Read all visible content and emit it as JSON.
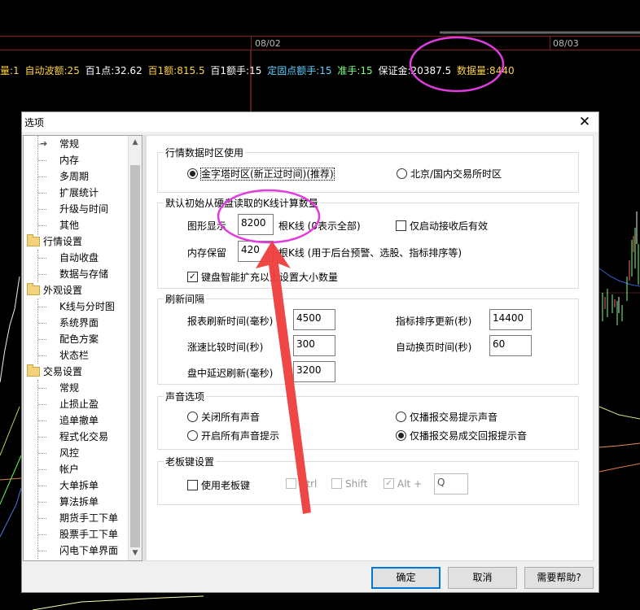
{
  "chart": {
    "dates": [
      "08/02",
      "08/03"
    ],
    "stats": [
      {
        "text": "量:1",
        "color": "#ffd23f"
      },
      {
        "text": "自动波额:25",
        "color": "#ffd23f"
      },
      {
        "text": "百1点:32.62",
        "color": "#ffffff"
      },
      {
        "text": "百1额:815.5",
        "color": "#ffd23f"
      },
      {
        "text": "百1额手:15",
        "color": "#ffffff"
      },
      {
        "text": "定固点额手:15",
        "color": "#5ad1ff"
      },
      {
        "text": "准手:15",
        "color": "#7dff7d"
      },
      {
        "text": "保证金:20387.5",
        "color": "#ffffff"
      },
      {
        "text": "数据量:8440",
        "color": "#ffd23f"
      }
    ]
  },
  "dialog": {
    "title": "选项",
    "close_glyph": "✕",
    "tree": {
      "items": [
        {
          "label": "常规",
          "level": 2,
          "selected": true
        },
        {
          "label": "内存",
          "level": 2
        },
        {
          "label": "多周期",
          "level": 2
        },
        {
          "label": "扩展统计",
          "level": 2
        },
        {
          "label": "升级与时间",
          "level": 2
        },
        {
          "label": "其他",
          "level": 2
        },
        {
          "label": "行情设置",
          "level": 1
        },
        {
          "label": "自动收盘",
          "level": 2
        },
        {
          "label": "数据与存储",
          "level": 2
        },
        {
          "label": "外观设置",
          "level": 1
        },
        {
          "label": "K线与分时图",
          "level": 2
        },
        {
          "label": "系统界面",
          "level": 2
        },
        {
          "label": "配色方案",
          "level": 2
        },
        {
          "label": "状态栏",
          "level": 2
        },
        {
          "label": "交易设置",
          "level": 1
        },
        {
          "label": "常规",
          "level": 2
        },
        {
          "label": "止损止盈",
          "level": 2
        },
        {
          "label": "追单撤单",
          "level": 2
        },
        {
          "label": "程式化交易",
          "level": 2
        },
        {
          "label": "风控",
          "level": 2
        },
        {
          "label": "帐户",
          "level": 2
        },
        {
          "label": "大单拆单",
          "level": 2
        },
        {
          "label": "算法拆单",
          "level": 2
        },
        {
          "label": "期货手工下单",
          "level": 2
        },
        {
          "label": "股票手工下单",
          "level": 2
        },
        {
          "label": "闪电下单界面",
          "level": 2
        }
      ]
    },
    "timezone": {
      "title": "行情数据时区使用",
      "option1": "金字塔时区(新正过时间)(推荐)",
      "option2": "北京/国内交易所时区"
    },
    "kline": {
      "title": "默认初始从硬盘读取的K线计算数量",
      "display_label": "图形显示",
      "display_value": "8200",
      "display_suffix": "根K线 (0表示全部)",
      "only_auto_label": "仅启动接收后有效",
      "memory_label": "内存保留",
      "memory_value": "420",
      "memory_suffix": "根K线  (用于后台预警、选股、指标排序等)",
      "keyboard_expand_label": "键盘智能扩充以上设置大小数量"
    },
    "refresh": {
      "title": "刷新间隔",
      "report_label": "报表刷新时间(毫秒)",
      "report_value": "4500",
      "indicator_label": "指标排序更新(秒)",
      "indicator_value": "14400",
      "rise_label": "涨速比较时间(秒)",
      "rise_value": "300",
      "autopage_label": "自动换页时间(秒)",
      "autopage_value": "60",
      "delay_label": "盘中延迟刷新(毫秒)",
      "delay_value": "3200"
    },
    "sound": {
      "title": "声音选项",
      "close_all": "关闭所有声音",
      "trade_prompt_only": "仅播报交易提示声音",
      "open_all": "开启所有声音提示",
      "trade_report_only": "仅播报交易成交回报提示音"
    },
    "boss_key": {
      "title": "老板键设置",
      "use_label": "使用老板键",
      "ctrl": "Ctrl",
      "shift": "Shift",
      "alt": "Alt +",
      "key_value": "Q"
    },
    "buttons": {
      "ok": "确定",
      "cancel": "取消",
      "help": "需要帮助?"
    }
  }
}
